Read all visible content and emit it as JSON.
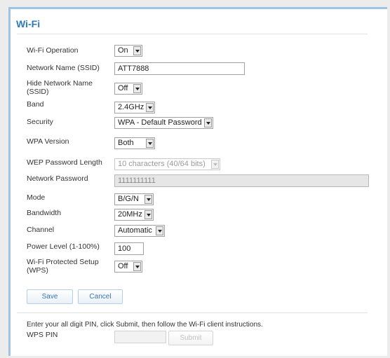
{
  "page": {
    "title": "Wi-Fi"
  },
  "form": {
    "wifi_operation": {
      "label": "Wi-Fi Operation",
      "value": "On"
    },
    "network_name": {
      "label": "Network Name (SSID)",
      "value": "ATT7888"
    },
    "hide_network_name": {
      "label": "Hide Network Name (SSID)",
      "value": "Off"
    },
    "band": {
      "label": "Band",
      "value": "2.4GHz"
    },
    "security": {
      "label": "Security",
      "value": "WPA - Default Password"
    },
    "wpa_version": {
      "label": "WPA Version",
      "value": "Both"
    },
    "wep_password_length": {
      "label": "WEP Password Length",
      "value": "10 characters (40/64 bits)"
    },
    "network_password": {
      "label": "Network Password",
      "value": "1111111111"
    },
    "mode": {
      "label": "Mode",
      "value": "B/G/N"
    },
    "bandwidth": {
      "label": "Bandwidth",
      "value": "20MHz"
    },
    "channel": {
      "label": "Channel",
      "value": "Automatic"
    },
    "power_level": {
      "label": "Power Level (1-100%)",
      "value": "100"
    },
    "wps": {
      "label": "Wi-Fi Protected Setup (WPS)",
      "value": "Off"
    }
  },
  "buttons": {
    "save": "Save",
    "cancel": "Cancel",
    "submit": "Submit"
  },
  "wps_section": {
    "instruction": "Enter your all digit PIN, click Submit, then follow the Wi-Fi client instructions.",
    "pin_label": "WPS PIN",
    "pin_value": ""
  },
  "colors": {
    "accent": "#2b7bc0",
    "panel_border": "#9fc3e6"
  }
}
